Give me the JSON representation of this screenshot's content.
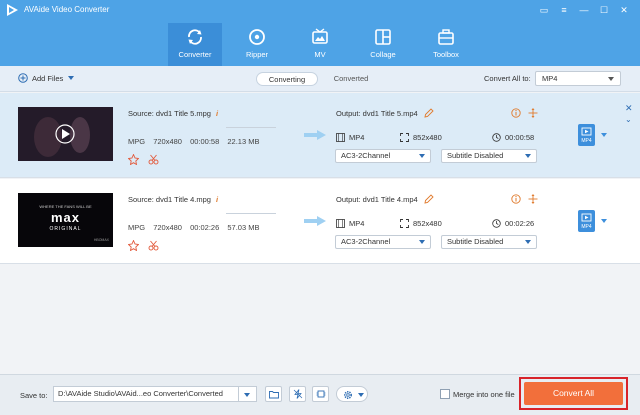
{
  "app": {
    "title": "AVAide Video Converter"
  },
  "window_controls": [
    {
      "name": "chat-icon",
      "glyph": "▭"
    },
    {
      "name": "menu-icon",
      "glyph": "≡"
    },
    {
      "name": "minimize-icon",
      "glyph": "—"
    },
    {
      "name": "maximize-icon",
      "glyph": "☐"
    },
    {
      "name": "close-icon",
      "glyph": "✕"
    }
  ],
  "nav": {
    "tabs": [
      {
        "label": "Converter",
        "icon": "converter-icon",
        "active": true
      },
      {
        "label": "Ripper",
        "icon": "ripper-icon"
      },
      {
        "label": "MV",
        "icon": "mv-icon"
      },
      {
        "label": "Collage",
        "icon": "collage-icon"
      },
      {
        "label": "Toolbox",
        "icon": "toolbox-icon"
      }
    ]
  },
  "toolbar": {
    "add_files_label": "Add Files",
    "view_tabs": [
      {
        "label": "Converting",
        "active": true
      },
      {
        "label": "Converted"
      }
    ],
    "convert_all_to_label": "Convert All to:",
    "convert_all_to_value": "MP4"
  },
  "files": [
    {
      "source": "Source: dvd1 Title 5.mpg",
      "in_format": "MPG",
      "in_resolution": "720x480",
      "in_duration": "00:00:58",
      "in_size": "22.13 MB",
      "output": "Output: dvd1 Title 5.mp4",
      "out_format": "MP4",
      "out_resolution": "852x480",
      "out_duration": "00:00:58",
      "audio": "AC3-2Channel",
      "subtitle": "Subtitle Disabled",
      "badge": "MP4",
      "selected": true
    },
    {
      "source": "Source: dvd1 Title 4.mpg",
      "in_format": "MPG",
      "in_resolution": "720x480",
      "in_duration": "00:02:26",
      "in_size": "57.03 MB",
      "output": "Output: dvd1 Title 4.mp4",
      "out_format": "MP4",
      "out_resolution": "852x480",
      "out_duration": "00:02:26",
      "audio": "AC3-2Channel",
      "subtitle": "Subtitle Disabled",
      "badge": "MP4",
      "selected": false,
      "thumb_text": {
        "line1": "WHERE THE FANS WILL BE",
        "brand": "max",
        "sub": "ORIGINAL",
        "tag": "HBOMAX"
      }
    }
  ],
  "bottom": {
    "save_to_label": "Save to:",
    "save_path": "D:\\AVAide Studio\\AVAid...eo Converter\\Converted",
    "merge_label": "Merge into one file",
    "convert_all_label": "Convert All"
  },
  "colors": {
    "accent": "#4ea3e6",
    "convert_button": "#f26f3b",
    "highlight_frame": "#d8232a"
  }
}
